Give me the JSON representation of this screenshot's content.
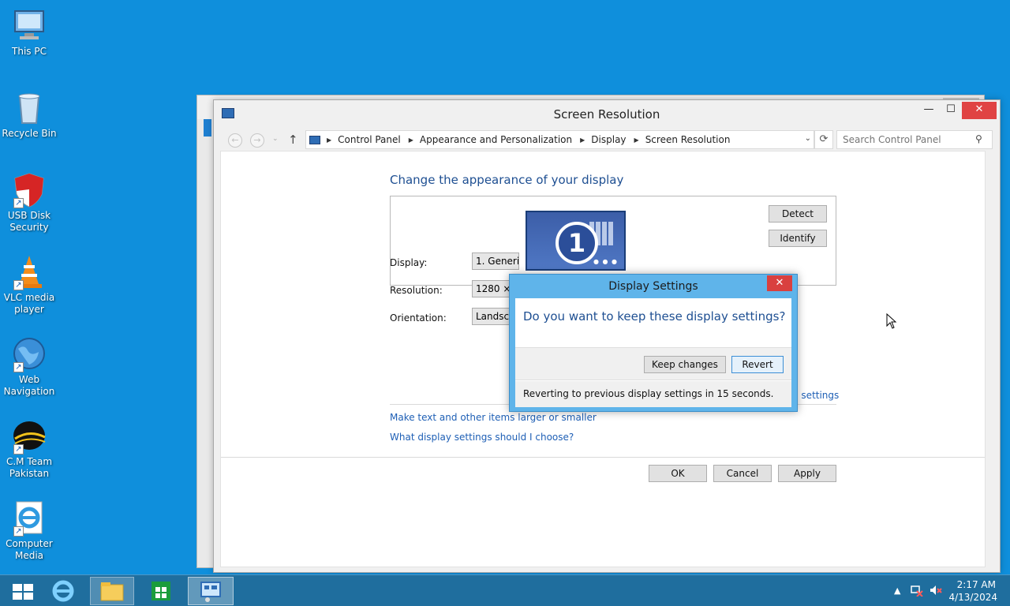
{
  "desktop": {
    "icons": [
      {
        "label": "This PC"
      },
      {
        "label": "Recycle Bin"
      },
      {
        "label": "USB Disk Security"
      },
      {
        "label": "VLC media player"
      },
      {
        "label": "Web Navigation"
      },
      {
        "label": "C.M Team Pakistan"
      },
      {
        "label": "Computer Media"
      }
    ]
  },
  "window": {
    "title": "Screen Resolution",
    "min_glyph": "—",
    "max_glyph": "☐",
    "close_glyph": "✕",
    "nav": {
      "back": "←",
      "forward": "→",
      "history": "⌄",
      "up": "↑",
      "refresh": "⟳",
      "dropdown": "⌄"
    },
    "breadcrumbs": [
      "Control Panel",
      "Appearance and Personalization",
      "Display",
      "Screen Resolution"
    ],
    "search_placeholder": "Search Control Panel",
    "search_glyph": "⚲",
    "heading": "Change the appearance of your display",
    "monitor_number": "1",
    "detect_label": "Detect",
    "identify_label": "Identify",
    "fields": [
      {
        "label": "Display:",
        "value": "1. Generic"
      },
      {
        "label": "Resolution:",
        "value": "1280 × 768"
      },
      {
        "label": "Orientation:",
        "value": "Landscape"
      }
    ],
    "advanced_link": "d settings",
    "links": [
      "Make text and other items larger or smaller",
      "What display settings should I choose?"
    ],
    "ok_label": "OK",
    "cancel_label": "Cancel",
    "apply_label": "Apply"
  },
  "dialog": {
    "title": "Display Settings",
    "close_glyph": "✕",
    "question": "Do you want to keep these display settings?",
    "keep_label": "Keep changes",
    "revert_label": "Revert",
    "status": "Reverting to previous display settings in 15 seconds."
  },
  "taskbar": {
    "tray_arrow": "▲",
    "time": "2:17 AM",
    "date": "4/13/2024"
  },
  "colors": {
    "desktop": "#0f8fdc",
    "accent": "#1e4f92",
    "link": "#1e5fb5",
    "close": "#e04343",
    "taskbar": "#1f6e9e"
  }
}
